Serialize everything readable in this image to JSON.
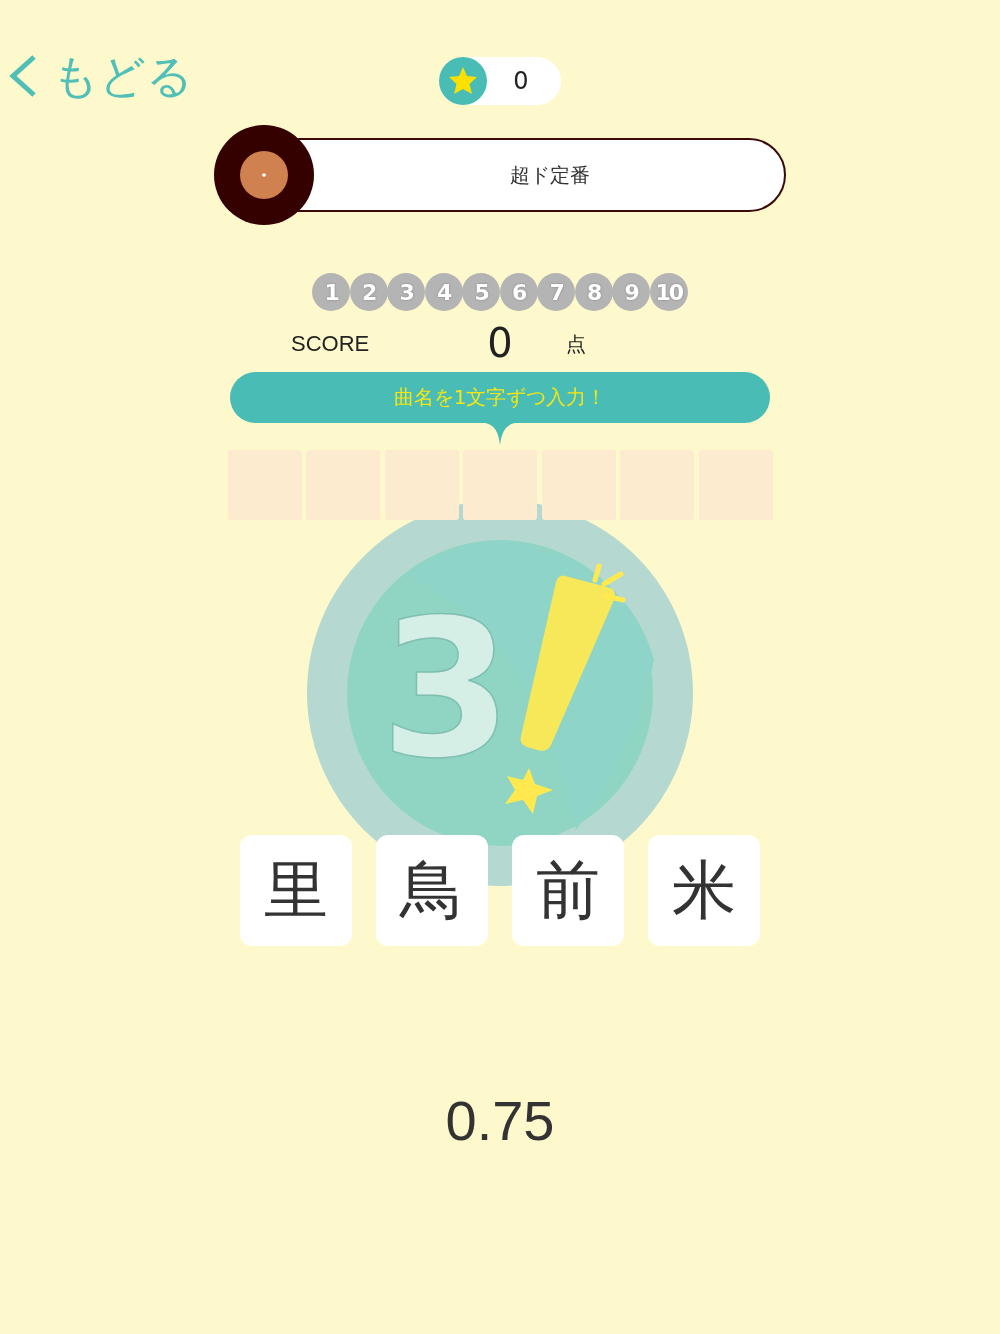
{
  "back_link": {
    "label": "もどる"
  },
  "coins": {
    "count": "0"
  },
  "genre": {
    "title": "超ド定番"
  },
  "questions": [
    {
      "number": "1"
    },
    {
      "number": "2"
    },
    {
      "number": "3"
    },
    {
      "number": "4"
    },
    {
      "number": "5"
    },
    {
      "number": "6"
    },
    {
      "number": "7"
    },
    {
      "number": "8"
    },
    {
      "number": "9"
    },
    {
      "number": "10"
    }
  ],
  "score": {
    "label": "SCORE",
    "value": "0",
    "unit": "点"
  },
  "hint": {
    "text": "曲名を1文字ずつ入力！"
  },
  "answer_slots": [
    {
      "filled": false
    },
    {
      "filled": false
    },
    {
      "filled": false
    },
    {
      "filled": false
    },
    {
      "filled": false
    },
    {
      "filled": false
    },
    {
      "filled": false
    }
  ],
  "countdown": {
    "digit": "3"
  },
  "choices": [
    {
      "char": "里"
    },
    {
      "char": "鳥"
    },
    {
      "char": "前"
    },
    {
      "char": "米"
    }
  ],
  "timer": "0.75"
}
